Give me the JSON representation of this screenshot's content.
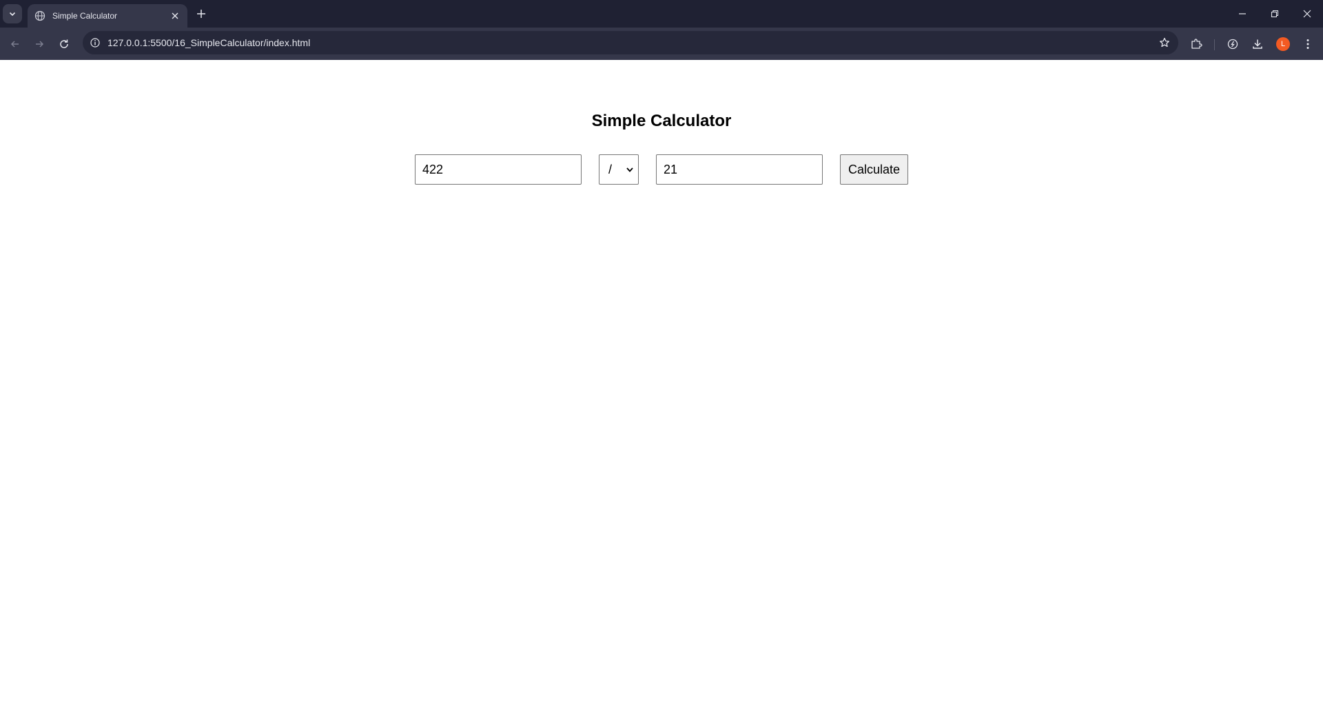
{
  "browser": {
    "tab": {
      "title": "Simple Calculator"
    },
    "address": {
      "url": "127.0.0.1:5500/16_SimpleCalculator/index.html"
    },
    "profile_initial": "L",
    "profile_color": "#f35a22"
  },
  "page": {
    "title": "Simple Calculator",
    "calculator": {
      "first_number": "422",
      "operator": "/",
      "second_number": "21",
      "button_label": "Calculate"
    }
  }
}
